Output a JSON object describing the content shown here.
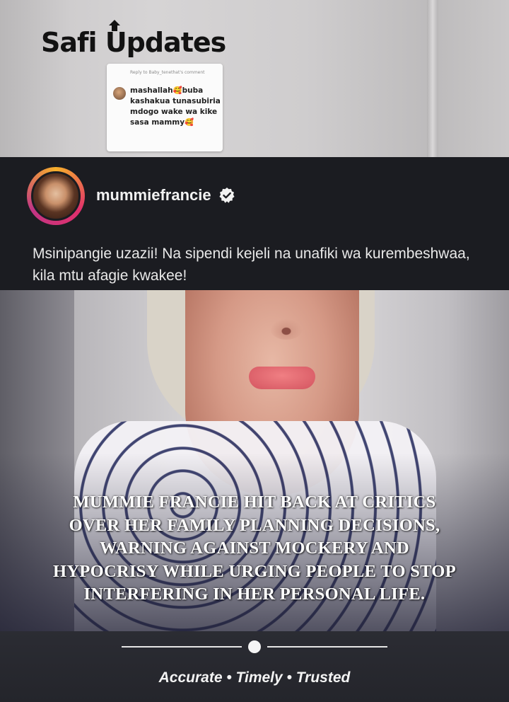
{
  "brand": {
    "name_part1": "Safi ",
    "name_part2": "pdates",
    "arrow_icon": "up-arrow-icon"
  },
  "reply_card": {
    "reply_to": "Reply to Baby_tenethat's comment",
    "text": "mashallah🥰buba kashakua tunasubiria mdogo wake wa kike sasa mammy🥰"
  },
  "post": {
    "username": "mummiefrancie",
    "verified_icon": "verified-badge-icon",
    "caption": "Msinipangie uzazii! Na sipendi kejeli na unafiki wa kurembeshwaa, kila mtu afagie kwakee!"
  },
  "video": {
    "headline": "MUMMIE FRANCIE HIT BACK AT CRITICS OVER HER FAMILY PLANNING DECISIONS, WARNING AGAINST MOCKERY AND HYPOCRISY WHILE URGING PEOPLE TO STOP INTERFERING IN HER PERSONAL LIFE."
  },
  "footer": {
    "tagline": "Accurate • Timely • Trusted"
  },
  "colors": {
    "header_bg": "#1b1c21",
    "footer_bg": "#24252b",
    "ring_gradient": [
      "#f7b02b",
      "#e1306c",
      "#c13584"
    ]
  }
}
